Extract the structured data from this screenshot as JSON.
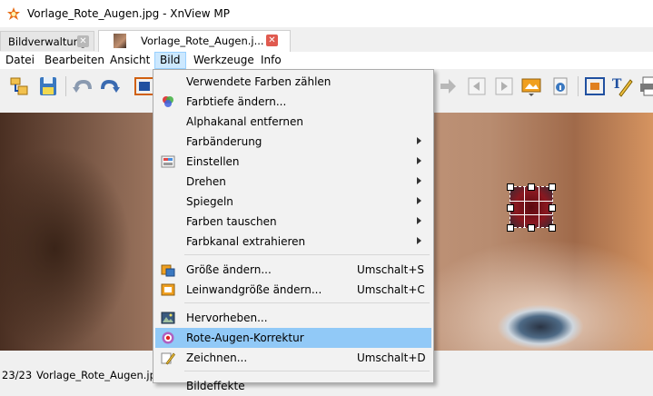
{
  "window": {
    "title": "Vorlage_Rote_Augen.jpg - XnView MP"
  },
  "tabs": [
    {
      "label": "Bildverwaltung",
      "close": "✕"
    },
    {
      "label": "Vorlage_Rote_Augen.j...",
      "close": "✕"
    }
  ],
  "menubar": [
    "Datei",
    "Bearbeiten",
    "Ansicht",
    "Bild",
    "Werkzeuge",
    "Info"
  ],
  "active_menu": "Bild",
  "bild_menu": {
    "items": [
      {
        "label": "Verwendete Farben zählen",
        "shortcut": "",
        "submenu": false,
        "icon": ""
      },
      {
        "label": "Farbtiefe ändern...",
        "shortcut": "",
        "submenu": false,
        "icon": "color-depth-icon"
      },
      {
        "label": "Alphakanal entfernen",
        "shortcut": "",
        "submenu": false,
        "icon": ""
      },
      {
        "label": "Farbänderung",
        "shortcut": "",
        "submenu": true,
        "icon": ""
      },
      {
        "label": "Einstellen",
        "shortcut": "",
        "submenu": true,
        "icon": "adjust-icon"
      },
      {
        "label": "Drehen",
        "shortcut": "",
        "submenu": true,
        "icon": ""
      },
      {
        "label": "Spiegeln",
        "shortcut": "",
        "submenu": true,
        "icon": ""
      },
      {
        "label": "Farben tauschen",
        "shortcut": "",
        "submenu": true,
        "icon": ""
      },
      {
        "label": "Farbkanal extrahieren",
        "shortcut": "",
        "submenu": true,
        "icon": ""
      },
      {
        "label": "Größe ändern...",
        "shortcut": "Umschalt+S",
        "submenu": false,
        "icon": "resize-icon"
      },
      {
        "label": "Leinwandgröße ändern...",
        "shortcut": "Umschalt+C",
        "submenu": false,
        "icon": "canvas-size-icon"
      },
      {
        "label": "Hervorheben...",
        "shortcut": "",
        "submenu": false,
        "icon": "highlight-icon"
      },
      {
        "label": "Rote-Augen-Korrektur",
        "shortcut": "",
        "submenu": false,
        "icon": "red-eye-icon",
        "highlighted": true
      },
      {
        "label": "Zeichnen...",
        "shortcut": "Umschalt+D",
        "submenu": false,
        "icon": "draw-icon"
      },
      {
        "label": "Bildeffekte",
        "shortcut": "",
        "submenu": false,
        "icon": ""
      }
    ]
  },
  "statusbar": {
    "count": "23/23",
    "filename": "Vorlage_Rote_Augen.jpg"
  },
  "colors": {
    "highlight": "#91c9f7",
    "menu_active": "#cce8ff",
    "tab_close_active": "#e05a4f"
  }
}
